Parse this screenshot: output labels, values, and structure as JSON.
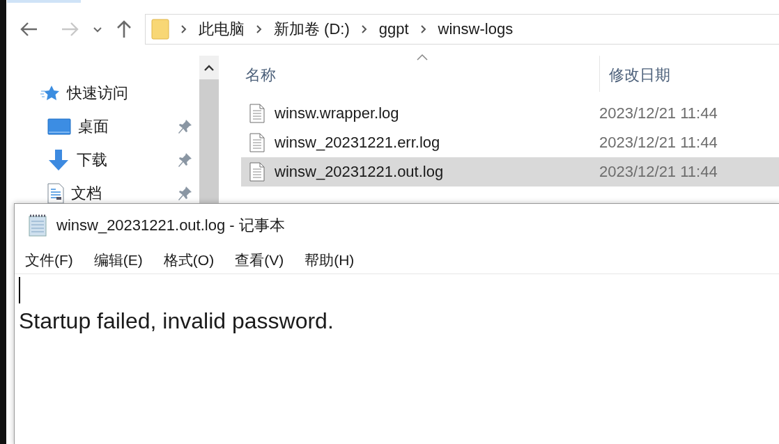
{
  "explorer": {
    "nav_buttons": [
      {
        "kind": "back",
        "disabled": false
      },
      {
        "kind": "forward",
        "disabled": true
      },
      {
        "kind": "recent",
        "disabled": false
      },
      {
        "kind": "up",
        "disabled": false
      }
    ],
    "address": [
      "此电脑",
      "新加卷 (D:)",
      "ggpt",
      "winsw-logs"
    ],
    "sidebar": {
      "items": [
        {
          "kind": "quick-access",
          "label": "快速访问",
          "pinned": false
        },
        {
          "kind": "desktop",
          "label": "桌面",
          "pinned": true
        },
        {
          "kind": "downloads",
          "label": "下载",
          "pinned": true
        },
        {
          "kind": "documents",
          "label": "文档",
          "pinned": true
        }
      ]
    },
    "table": {
      "columns": [
        {
          "label": "名称",
          "sorted": true
        },
        {
          "label": "修改日期",
          "sorted": false
        }
      ],
      "rows": [
        {
          "name": "winsw.wrapper.log",
          "modified": "2023/12/21 11:44",
          "selected": false
        },
        {
          "name": "winsw_20231221.err.log",
          "modified": "2023/12/21 11:44",
          "selected": false
        },
        {
          "name": "winsw_20231221.out.log",
          "modified": "2023/12/21 11:44",
          "selected": true
        }
      ]
    }
  },
  "notepad": {
    "title": "winsw_20231221.out.log - 记事本",
    "menu": [
      "文件(F)",
      "编辑(E)",
      "格式(O)",
      "查看(V)",
      "帮助(H)"
    ],
    "lines": [
      "Startup failed, invalid password."
    ]
  }
}
